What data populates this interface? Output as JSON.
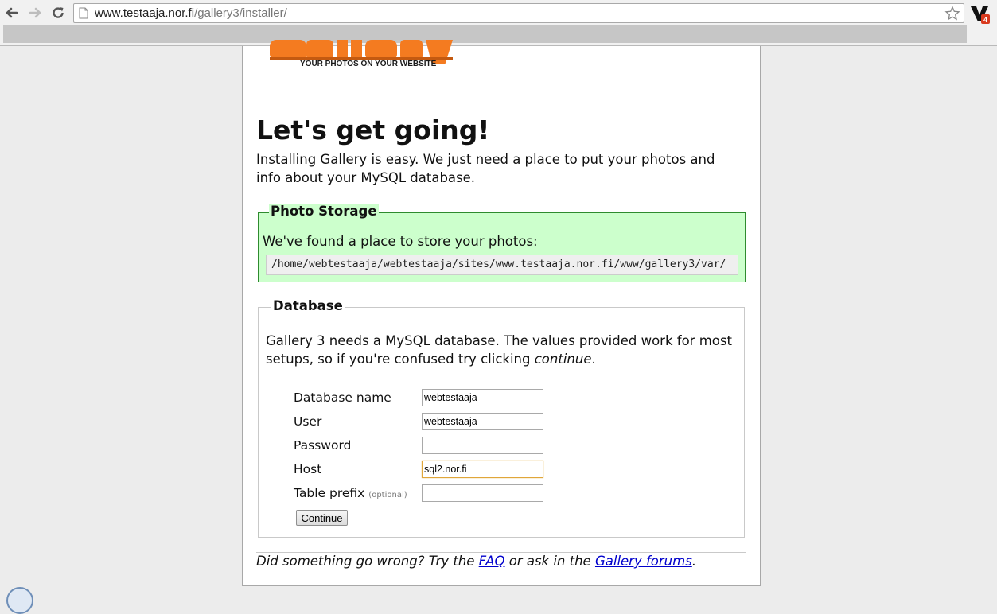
{
  "browser": {
    "url_host": "www.testaaja.nor.fi",
    "url_path": "/gallery3/installer/"
  },
  "logo": {
    "tagline": "YOUR PHOTOS ON YOUR WEBSITE",
    "color": "#f47b20"
  },
  "page": {
    "title": "Let's get going!",
    "intro": "Installing Gallery is easy. We just need a place to put your photos and info about your MySQL database."
  },
  "photo_storage": {
    "legend": "Photo Storage",
    "found_text": "We've found a place to store your photos:",
    "path": "/home/webtestaaja/webtestaaja/sites/www.testaaja.nor.fi/www/gallery3/var/",
    "bg_color": "#ccffcc"
  },
  "database": {
    "legend": "Database",
    "desc_before": "Gallery 3 needs a MySQL database. The values provided work for most setups, so if you're confused try clicking ",
    "desc_em": "continue",
    "desc_after": ".",
    "fields": [
      {
        "label": "Database name",
        "value": "webtestaaja"
      },
      {
        "label": "User",
        "value": "webtestaaja"
      },
      {
        "label": "Password",
        "value": ""
      },
      {
        "label": "Host",
        "value": "sql2.nor.fi"
      },
      {
        "label": "Table prefix",
        "optional": "(optional)",
        "value": ""
      }
    ],
    "continue_label": "Continue"
  },
  "footer": {
    "before": "Did something go wrong? Try the ",
    "faq": "FAQ",
    "middle": " or ask in the ",
    "forums": "Gallery forums",
    "after": "."
  }
}
